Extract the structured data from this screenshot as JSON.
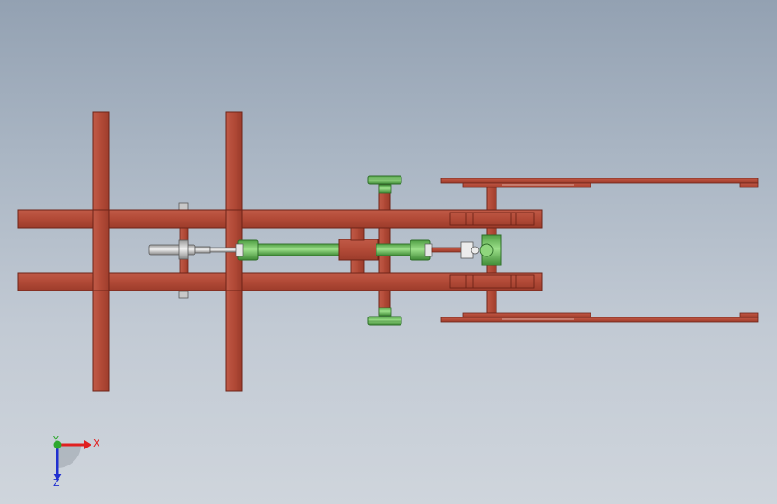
{
  "viewport": {
    "colors": {
      "frame_red": "#b54d3a",
      "frame_red_dark": "#6e2418",
      "frame_red_light": "#c96a57",
      "part_green": "#6cc25c",
      "part_green_dark": "#2f6e2a",
      "part_grey": "#d8d8d8",
      "part_grey_dark": "#6a6a6a",
      "axis_x": "#e02020",
      "axis_y": "#2ea82e",
      "axis_z": "#2030d0"
    }
  },
  "triad": {
    "x_label": "X",
    "y_label": "Y",
    "z_label": "Z"
  }
}
